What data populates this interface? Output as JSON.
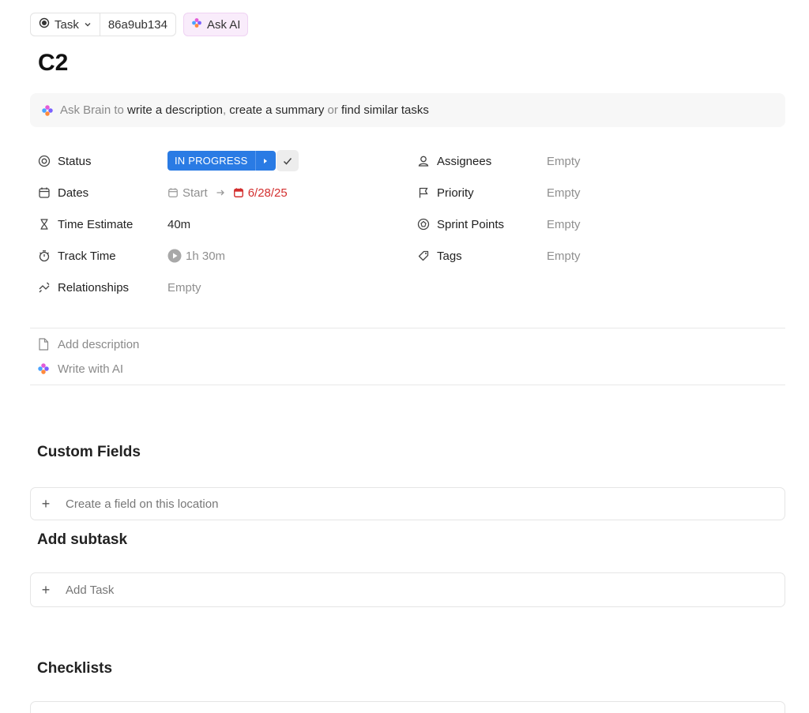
{
  "header": {
    "type_label": "Task",
    "task_id": "86a9ub134",
    "ask_ai_label": "Ask AI"
  },
  "task": {
    "title": "C2"
  },
  "brain_bar": {
    "prefix": "Ask Brain to",
    "action1": "write a description",
    "sep1": ",",
    "action2": "create a summary",
    "sep2": "or",
    "action3": "find similar tasks"
  },
  "fields_left": {
    "status": {
      "label": "Status",
      "value": "IN PROGRESS",
      "color": "#2a7be4"
    },
    "dates": {
      "label": "Dates",
      "start": "Start",
      "due": "6/28/25",
      "due_color": "#d32f2f"
    },
    "time_estimate": {
      "label": "Time Estimate",
      "value": "40m"
    },
    "track_time": {
      "label": "Track Time",
      "value": "1h 30m"
    },
    "relationships": {
      "label": "Relationships",
      "value": "Empty"
    }
  },
  "fields_right": {
    "assignees": {
      "label": "Assignees",
      "value": "Empty"
    },
    "priority": {
      "label": "Priority",
      "value": "Empty"
    },
    "sprint_points": {
      "label": "Sprint Points",
      "value": "Empty"
    },
    "tags": {
      "label": "Tags",
      "value": "Empty"
    }
  },
  "description": {
    "add_label": "Add description",
    "ai_label": "Write with AI"
  },
  "custom_fields": {
    "title": "Custom Fields",
    "create_label": "Create a field on this location"
  },
  "subtasks": {
    "title": "Add subtask",
    "add_label": "Add Task"
  },
  "checklists": {
    "title": "Checklists"
  }
}
